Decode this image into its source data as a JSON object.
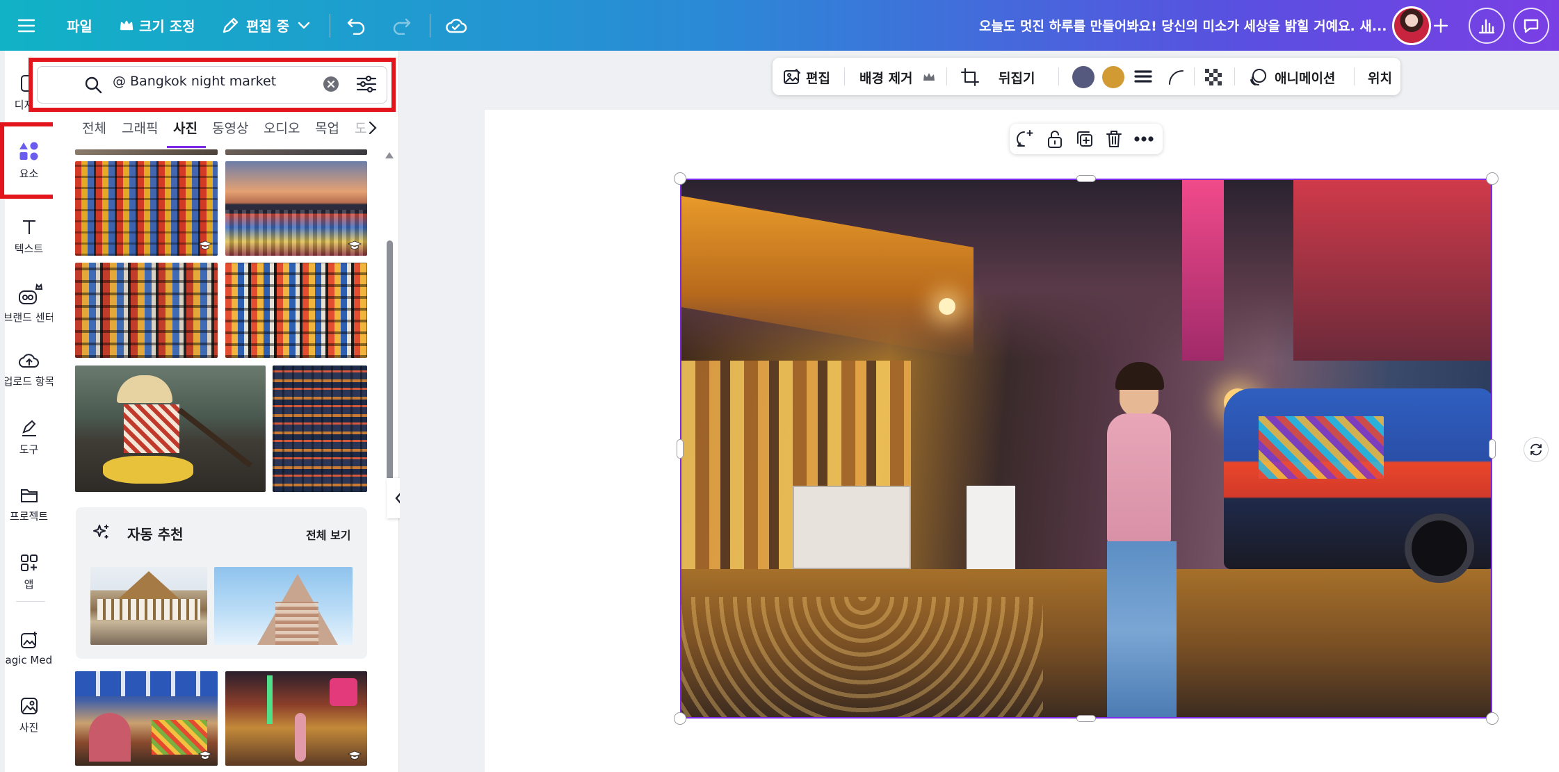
{
  "topbar": {
    "file_label": "파일",
    "resize_label": "크기 조정",
    "editing_label": "편집 중",
    "message": "오늘도 멋진 하루를 만들어봐요! 당신의 미소가 세상을 밝힐 거예요. 새..."
  },
  "rail": {
    "items": [
      {
        "label": "디자인"
      },
      {
        "label": "요소"
      },
      {
        "label": "텍스트"
      },
      {
        "label": "브랜드 센터"
      },
      {
        "label": "업로드 항목"
      },
      {
        "label": "도구"
      },
      {
        "label": "프로젝트"
      },
      {
        "label": "앱"
      },
      {
        "label": "Magic Media"
      },
      {
        "label": "사진"
      }
    ]
  },
  "search": {
    "value": "@ Bangkok night market"
  },
  "tabs": [
    {
      "label": "전체"
    },
    {
      "label": "그래픽"
    },
    {
      "label": "사진"
    },
    {
      "label": "동영상"
    },
    {
      "label": "오디오"
    },
    {
      "label": "목업"
    },
    {
      "label": "도"
    }
  ],
  "suggestions": {
    "title": "자동 추천",
    "see_all": "전체 보기"
  },
  "toolbar": {
    "edit": "편집",
    "bg_remove": "배경 제거",
    "flip": "뒤집기",
    "animation": "애니메이션",
    "position": "위치",
    "color1": "#55597e",
    "color2": "#d19a33"
  },
  "colors": {
    "accent": "#7d2ae8",
    "highlight": "#e2151d"
  }
}
